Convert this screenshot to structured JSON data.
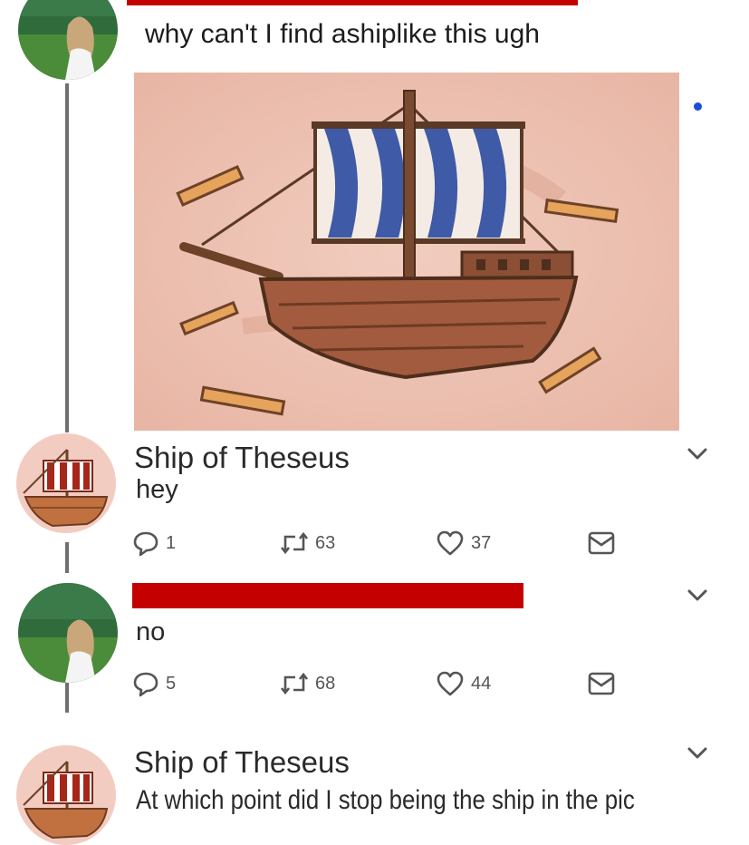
{
  "tweets": [
    {
      "text": "why can't I find ashiplike this ugh",
      "media_alt": "ship illustration"
    },
    {
      "author": "Ship of Theseus",
      "text": "hey",
      "replies": "1",
      "retweets": "63",
      "likes": "37"
    },
    {
      "text": "no",
      "replies": "5",
      "retweets": "68",
      "likes": "44"
    },
    {
      "author": "Ship of Theseus",
      "text": "At which point did I stop being the ship in the pic"
    }
  ],
  "colors": {
    "redaction": "#c40000",
    "accent_dot": "#1a4dd8",
    "thread_line": "#6f6f6f"
  },
  "icons": [
    "reply-icon",
    "retweet-icon",
    "like-icon",
    "dm-icon",
    "chevron-down-icon"
  ]
}
